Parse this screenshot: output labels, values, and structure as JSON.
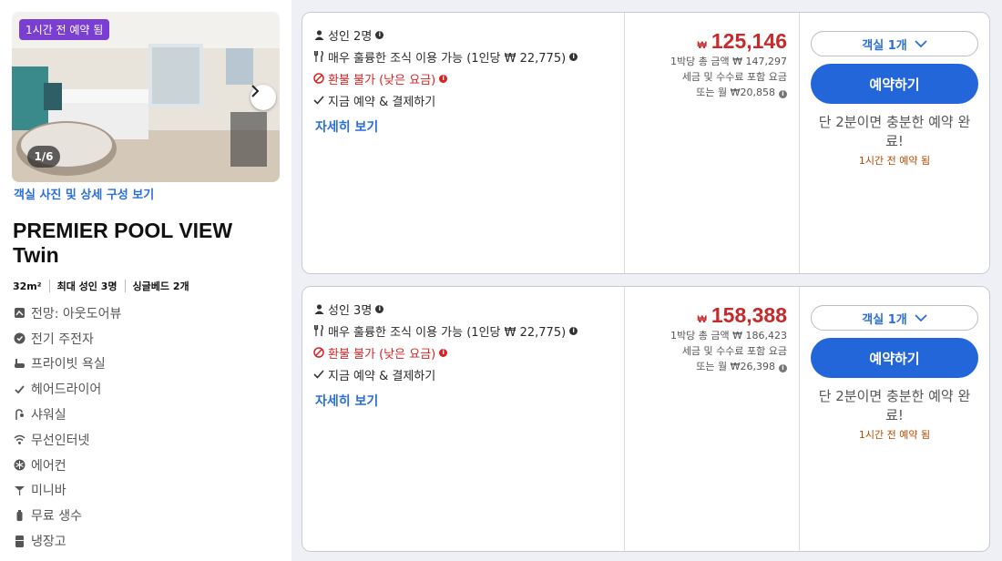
{
  "room": {
    "recent_badge": "1시간 전 예약 됨",
    "photo_counter": "1/6",
    "photo_link": "객실 사진 및 상세 구성 보기",
    "title": "PREMIER POOL VIEW Twin",
    "specs": [
      "32m²",
      "최대 성인 3명",
      "싱글베드 2개"
    ],
    "amenities": [
      {
        "icon": "view-icon",
        "label": "전망: 아웃도어뷰"
      },
      {
        "icon": "ev-charging-icon",
        "label": "전기 주전자"
      },
      {
        "icon": "bathtub-icon",
        "label": "프라이빗 욕실"
      },
      {
        "icon": "check-icon",
        "label": "헤어드라이어"
      },
      {
        "icon": "shower-icon",
        "label": "샤워실"
      },
      {
        "icon": "wifi-icon",
        "label": "무선인터넷"
      },
      {
        "icon": "aircon-icon",
        "label": "에어컨"
      },
      {
        "icon": "minibar-icon",
        "label": "미니바"
      },
      {
        "icon": "water-bottle-icon",
        "label": "무료 생수"
      },
      {
        "icon": "fridge-icon",
        "label": "냉장고"
      }
    ]
  },
  "offers": [
    {
      "guests": "성인 2명",
      "breakfast": "매우 훌륭한 조식 이용 가능 (1인당 ₩ 22,775)",
      "refund": "환불 불가 (낮은 요금)",
      "pay_now": "지금 예약 & 결제하기",
      "details": "자세히 보기",
      "currency": "₩",
      "price": "125,146",
      "total": "1박당 총 금액 ₩ 147,297",
      "tax_note": "세금 및 수수료 포함 요금",
      "monthly": "또는 월 ₩20,858",
      "room_select": "객실 1개",
      "book": "예약하기",
      "quick": "단 2분이면 충분한 예약 완료!",
      "recent": "1시간 전 예약 됨"
    },
    {
      "guests": "성인 3명",
      "breakfast": "매우 훌륭한 조식 이용 가능 (1인당 ₩ 22,775)",
      "refund": "환불 불가 (낮은 요금)",
      "pay_now": "지금 예약 & 결제하기",
      "details": "자세히 보기",
      "currency": "₩",
      "price": "158,388",
      "total": "1박당 총 금액 ₩ 186,423",
      "tax_note": "세금 및 수수료 포함 요금",
      "monthly": "또는 월 ₩26,398",
      "room_select": "객실 1개",
      "book": "예약하기",
      "quick": "단 2분이면 충분한 예약 완료!",
      "recent": "1시간 전 예약 됨"
    }
  ],
  "colors": {
    "accent": "#2266d9",
    "price": "#c72a2a",
    "badge": "#7a3fd1"
  }
}
